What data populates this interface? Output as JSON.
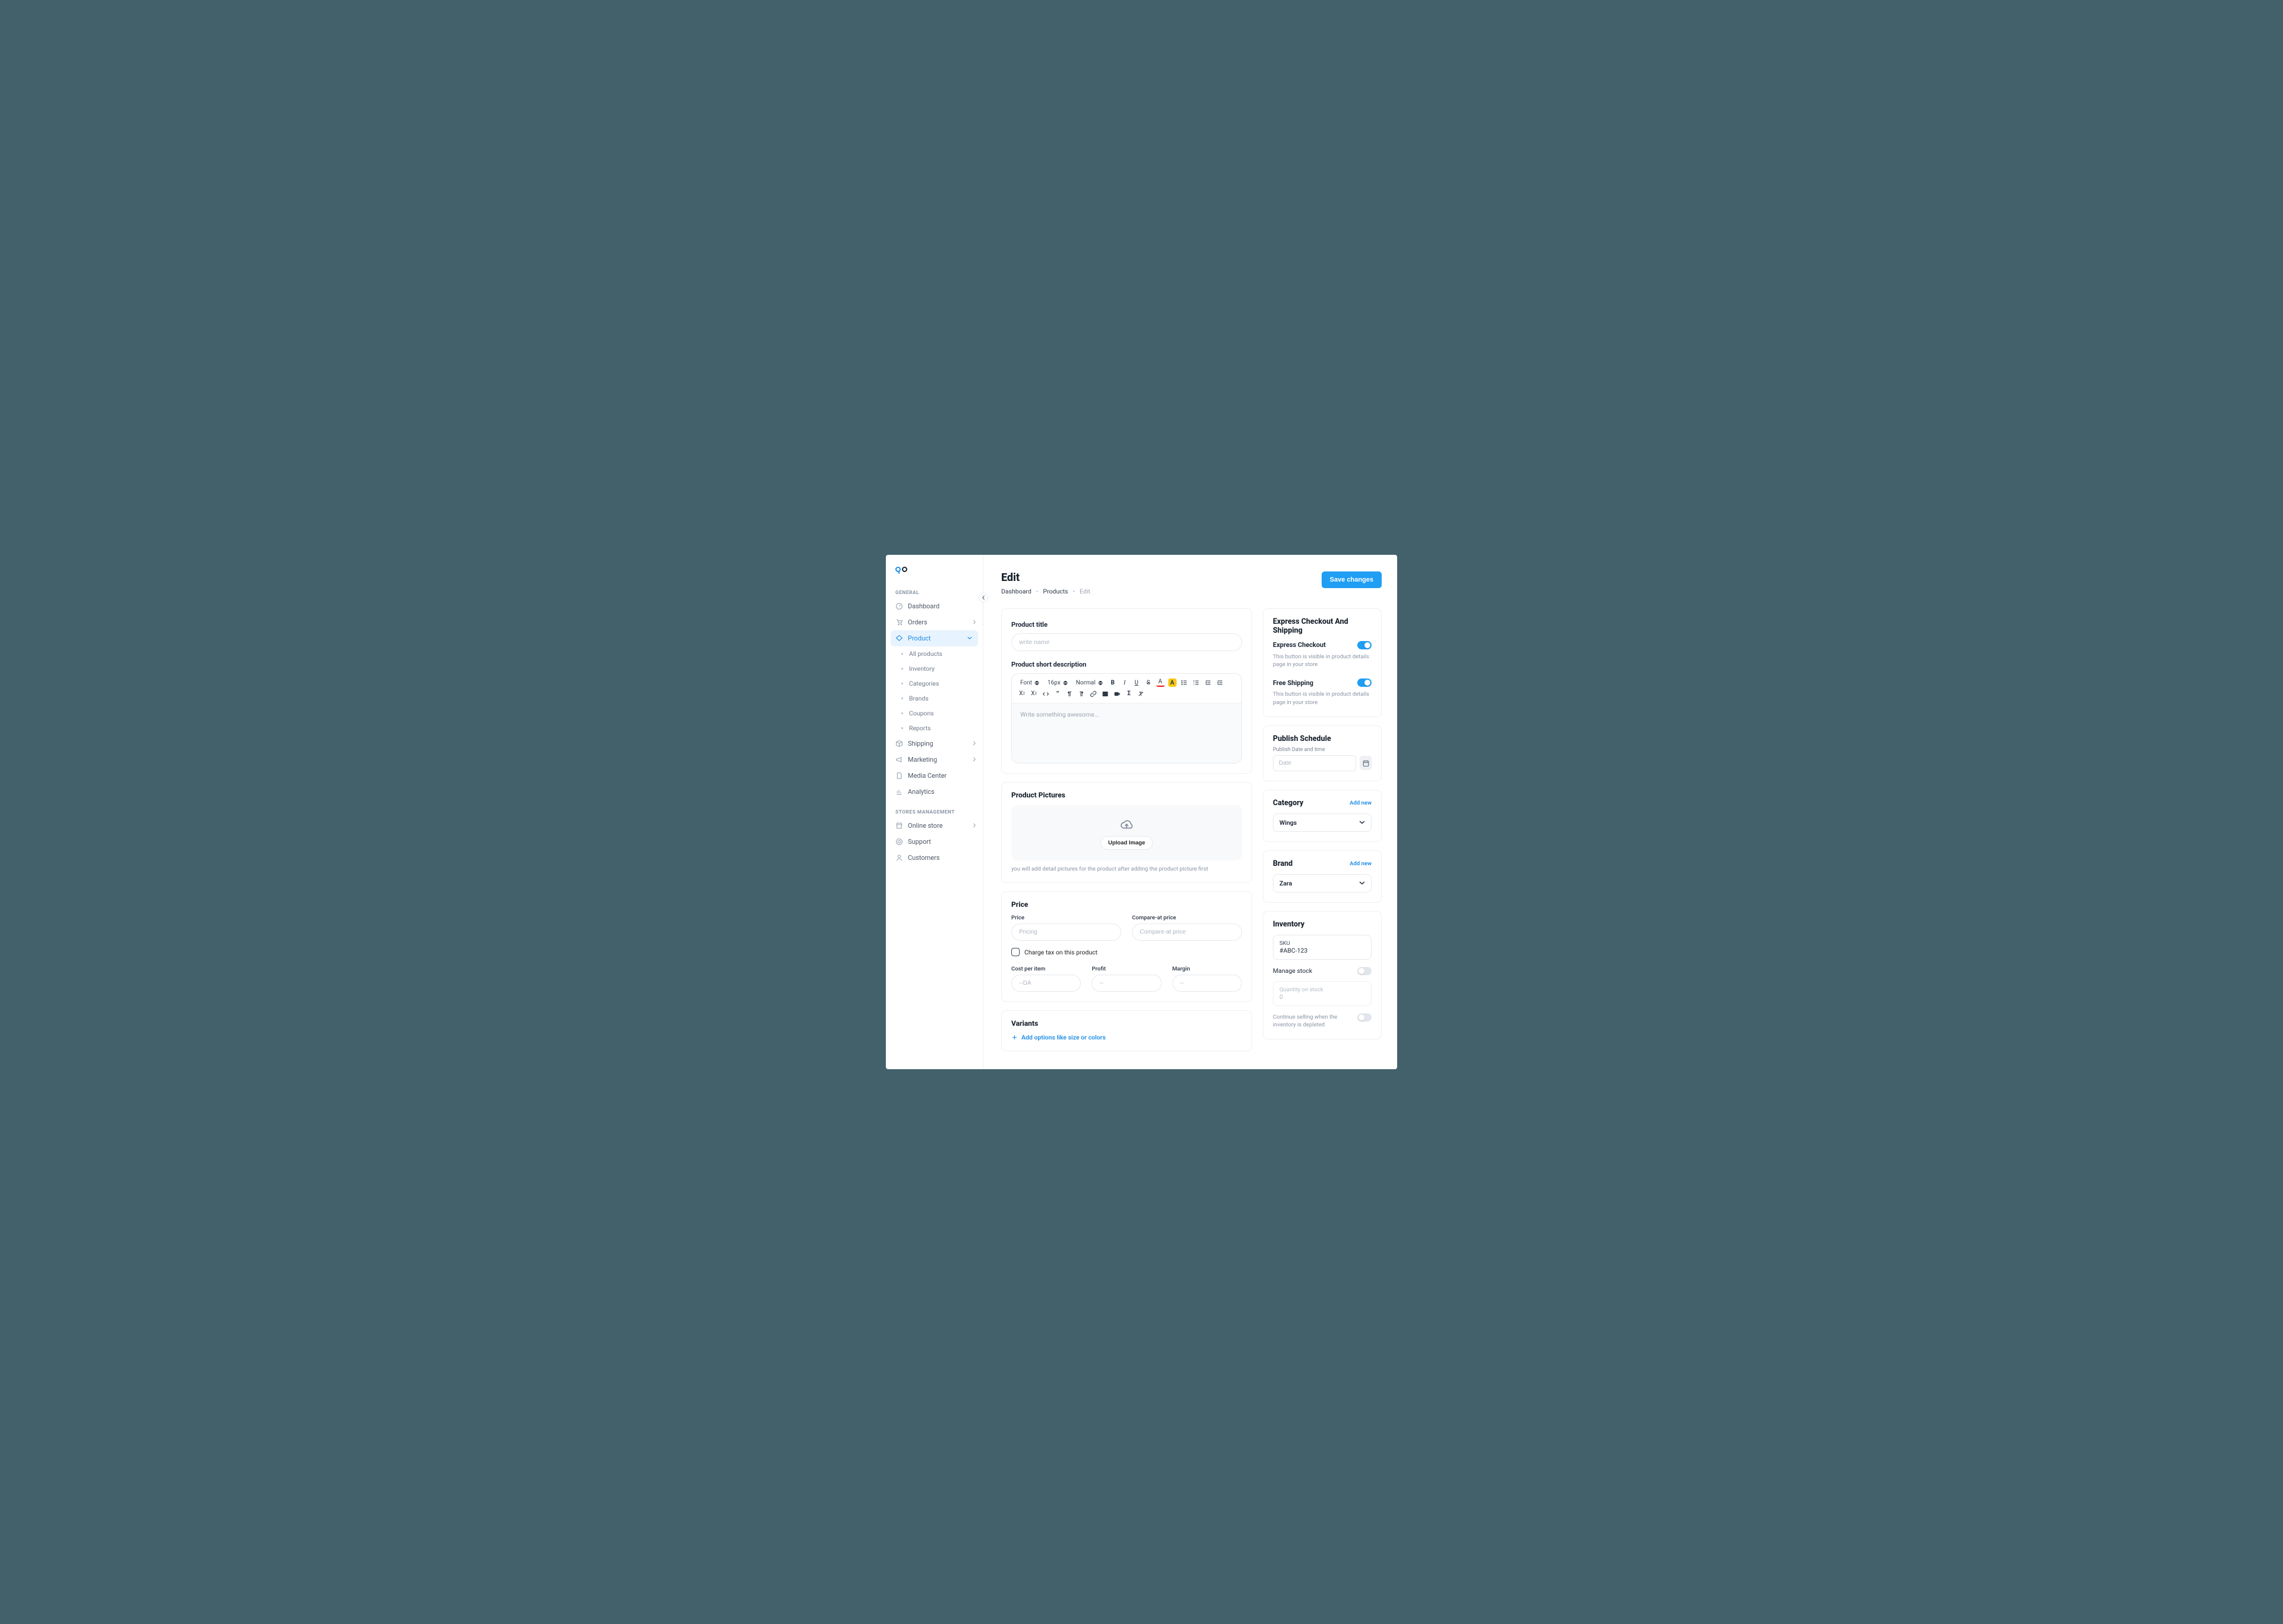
{
  "sidebar": {
    "headings": {
      "general": "GENERAL",
      "stores": "STORES MANAGEMENT"
    },
    "general": [
      {
        "label": "Dashboard"
      },
      {
        "label": "Orders",
        "expandable": true
      },
      {
        "label": "Product",
        "expandable": true,
        "active": true,
        "children": [
          "All products",
          "Inventory",
          "Categories",
          "Brands",
          "Coupons",
          "Reports"
        ]
      },
      {
        "label": "Shipping",
        "expandable": true
      },
      {
        "label": "Marketing",
        "expandable": true
      },
      {
        "label": "Media Center"
      },
      {
        "label": "Analytics"
      }
    ],
    "stores": [
      {
        "label": "Online store",
        "expandable": true
      },
      {
        "label": "Support"
      },
      {
        "label": "Customers"
      }
    ]
  },
  "header": {
    "title": "Edit",
    "crumbs": [
      "Dashboard",
      "Products",
      "Edit"
    ],
    "save": "Save changes"
  },
  "form": {
    "title_label": "Product title",
    "title_placeholder": "write name",
    "desc_label": "Product short description",
    "rte": {
      "font": "Font",
      "size": "16px",
      "weight": "Normal",
      "placeholder": "Write something awesome..."
    },
    "pictures": {
      "heading": "Product Pictures",
      "button": "Upload Image",
      "hint": "you will add detail pictures for the product after adding the product picture first"
    },
    "price": {
      "heading": "Price",
      "price_label": "Price",
      "price_placeholder": "Pricing",
      "compare_label": "Compare-at price",
      "compare_placeholder": "Compare-at price",
      "tax_label": "Charge tax on this product",
      "cost_label": "Cost per item",
      "cost_placeholder": "--DA",
      "profit_label": "Profit",
      "profit_placeholder": "--",
      "margin_label": "Margin",
      "margin_placeholder": "--"
    },
    "variants": {
      "heading": "Variants",
      "link": "Add options like size or colors"
    }
  },
  "express": {
    "heading": "Express Checkout And Shipping",
    "checkout_label": "Express Checkout",
    "checkout_hint": "This button is visible in product details page in your store",
    "freeship_label": "Free Shipping",
    "freeship_hint": "This button is visible in product details page in your store"
  },
  "schedule": {
    "heading": "Publish Schedule",
    "label": "Publish Date  and time",
    "placeholder": "Date"
  },
  "category": {
    "heading": "Category",
    "addnew": "Add new",
    "value": "Wings"
  },
  "brand": {
    "heading": "Brand",
    "addnew": "Add new",
    "value": "Zara"
  },
  "inventory": {
    "heading": "Inventory",
    "sku_label": "SKU",
    "sku_value": "#ABC-123",
    "manage_label": "Manage stock",
    "qty_label": "Quantity on stock",
    "qty_value": "0",
    "continue_label": "Continue selling when the inventory is depleted"
  }
}
